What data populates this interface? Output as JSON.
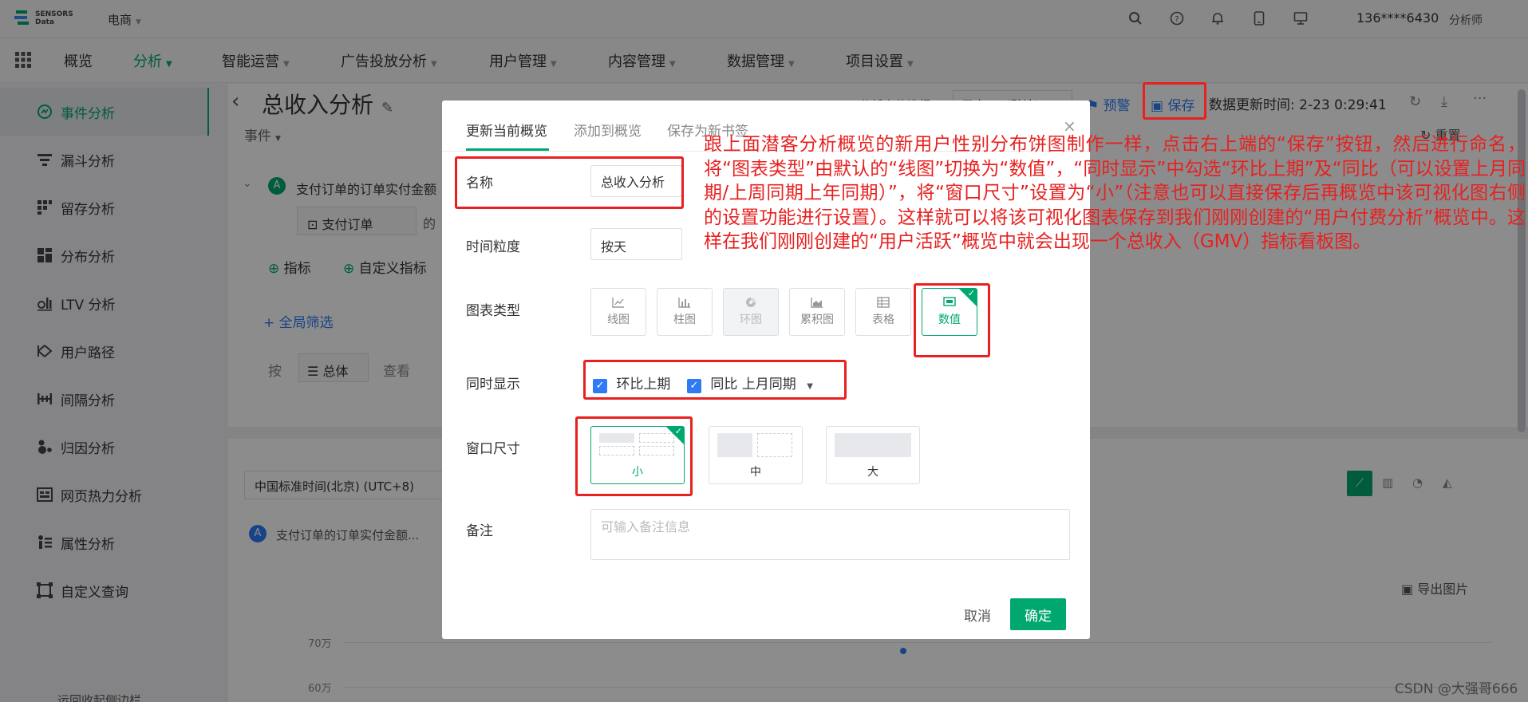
{
  "header": {
    "logo_line1": "SENSORS",
    "logo_line2": "Data",
    "project": "电商",
    "user": "136****6430",
    "role": "分析师"
  },
  "nav": {
    "items": [
      {
        "label": "概览"
      },
      {
        "label": "分析"
      },
      {
        "label": "智能运营"
      },
      {
        "label": "广告投放分析"
      },
      {
        "label": "用户管理"
      },
      {
        "label": "内容管理"
      },
      {
        "label": "数据管理"
      },
      {
        "label": "项目设置"
      }
    ]
  },
  "sidebar": {
    "items": [
      {
        "label": "事件分析"
      },
      {
        "label": "漏斗分析"
      },
      {
        "label": "留存分析"
      },
      {
        "label": "分布分析"
      },
      {
        "label": "LTV 分析"
      },
      {
        "label": "用户路径"
      },
      {
        "label": "间隔分析"
      },
      {
        "label": "归因分析"
      },
      {
        "label": "网页热力分析"
      },
      {
        "label": "属性分析"
      },
      {
        "label": "自定义查询"
      }
    ],
    "footer": "运回收起侧边栏"
  },
  "page": {
    "title": "总收入分析",
    "section_label": "事件",
    "event_letter": "A",
    "event_name": "支付订单的订单实付金额",
    "event_chip": "支付订单",
    "event_of": "的",
    "add_metric": "指标",
    "add_custom_metric": "自定义指标",
    "global_filter": "全局筛选",
    "by": "按",
    "group_total": "总体",
    "view": "查看",
    "timezone": "中国标准时间(北京) (UTC+8)",
    "legend_series": "支付订单的订单实付金额...",
    "analyze_subject": "分析主体选择",
    "subject_value": "用户 ID (默认)",
    "alert_label": "预警",
    "save_label": "保存",
    "update_time": "数据更新时间: 2-23 0:29:41",
    "reset_label": "重置",
    "export_label": "导出图片",
    "y_tick_70": "70万",
    "y_tick_60": "60万"
  },
  "modal": {
    "tabs": [
      {
        "label": "更新当前概览"
      },
      {
        "label": "添加到概览"
      },
      {
        "label": "保存为新书签"
      }
    ],
    "close": "×",
    "name_label": "名称",
    "name_value": "总收入分析",
    "granularity_label": "时间粒度",
    "granularity_value": "按天",
    "chart_type_label": "图表类型",
    "chart_types": [
      {
        "label": "线图",
        "icon": "line-chart-icon"
      },
      {
        "label": "柱图",
        "icon": "bar-chart-icon"
      },
      {
        "label": "环图",
        "icon": "donut-chart-icon"
      },
      {
        "label": "累积图",
        "icon": "area-chart-icon"
      },
      {
        "label": "表格",
        "icon": "table-icon"
      },
      {
        "label": "数值",
        "icon": "number-icon"
      }
    ],
    "show_label": "同时显示",
    "show_mom": "环比上期",
    "show_yoy": "同比 上月同期",
    "size_label": "窗口尺寸",
    "sizes": [
      {
        "label": "小"
      },
      {
        "label": "中"
      },
      {
        "label": "大"
      }
    ],
    "remark_label": "备注",
    "remark_placeholder": "可输入备注信息",
    "cancel": "取消",
    "confirm": "确定"
  },
  "annotation": "跟上面潜客分析概览的新用户性别分布饼图制作一样，点击右上端的“保存”按钮，然后进行命名，将“图表类型”由默认的“线图”切换为“数值”，“同时显示”中勾选“环比上期”及“同比（可以设置上月同期/上周同期上年同期）”，将“窗口尺寸”设置为“小”（注意也可以直接保存后再概览中该可视化图右侧的设置功能进行设置）。这样就可以将该可视化图表保存到我们刚刚创建的“用户付费分析”概览中。这样在我们刚刚创建的“用户活跃”概览中就会出现一个总收入（GMV）指标看板图。",
  "watermark": "CSDN @大强哥666",
  "colors": {
    "accent": "#00a870",
    "annotation": "#e82020",
    "checkbox": "#2f7bf6"
  }
}
